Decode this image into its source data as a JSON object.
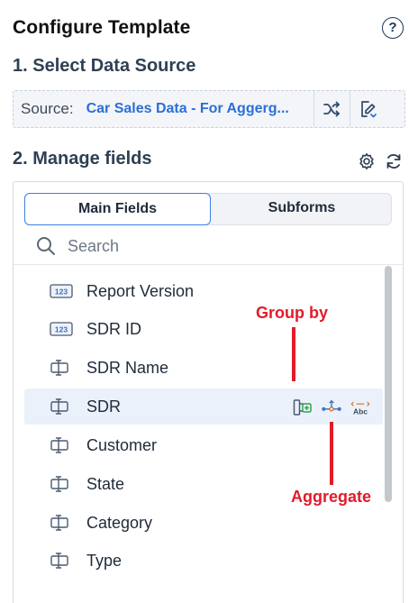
{
  "header": {
    "title": "Configure Template",
    "help_glyph": "?"
  },
  "section1": {
    "title": "1. Select Data Source"
  },
  "source": {
    "label": "Source:",
    "value": "Car Sales Data - For Aggerg...",
    "accent": "#2b6fd6"
  },
  "section2": {
    "title": "2. Manage fields"
  },
  "tabs": [
    {
      "label": "Main Fields",
      "active": true
    },
    {
      "label": "Subforms",
      "active": false
    }
  ],
  "search": {
    "placeholder": "Search"
  },
  "fields": [
    {
      "label": "Report Version",
      "icon": "number-field-icon"
    },
    {
      "label": "SDR ID",
      "icon": "number-field-icon"
    },
    {
      "label": "SDR Name",
      "icon": "text-field-icon"
    },
    {
      "label": "SDR",
      "icon": "text-field-icon",
      "hover": true
    },
    {
      "label": "Customer",
      "icon": "text-field-icon"
    },
    {
      "label": "State",
      "icon": "text-field-icon"
    },
    {
      "label": "Category",
      "icon": "text-field-icon"
    },
    {
      "label": "Type",
      "icon": "text-field-icon"
    }
  ],
  "row_action_icons": [
    "group-by-icon",
    "aggregate-icon",
    "text-format-icon"
  ],
  "annotations": {
    "group_by": "Group by",
    "aggregate": "Aggregate",
    "color": "#e21b2a"
  }
}
